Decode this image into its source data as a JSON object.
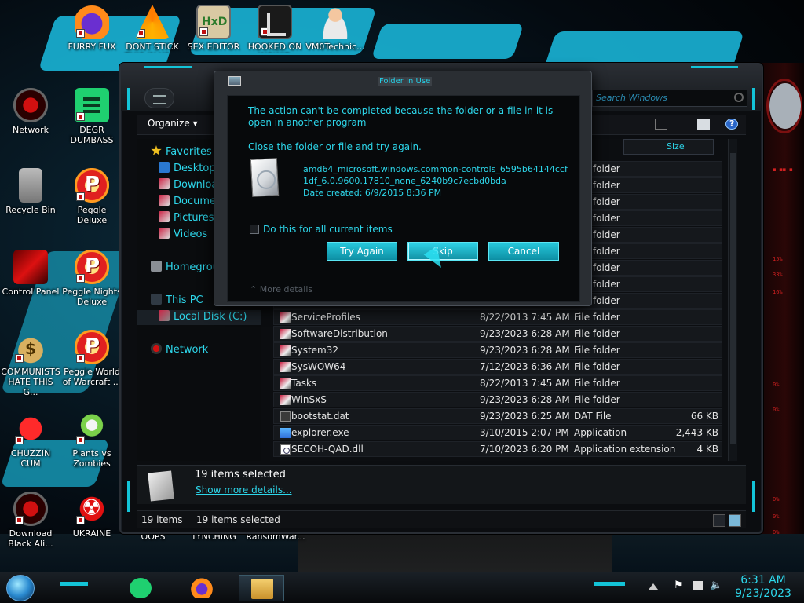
{
  "desktop": {
    "icons": [
      {
        "label": "FURRY FUX",
        "icon": "firefox-icon"
      },
      {
        "label": "DONT STICK THIS IN YO...",
        "icon": "vlc-icon"
      },
      {
        "label": "SEX EDITOR",
        "icon": "hxd-icon"
      },
      {
        "label": "HOOKED ON WOWIE",
        "icon": "hooked-icon"
      },
      {
        "label": "VM0Technic...",
        "icon": "doctor-icon"
      },
      {
        "label": "Network",
        "icon": "network-icon"
      },
      {
        "label": "DEGR DUMBASS",
        "icon": "green-app-icon"
      },
      {
        "label": "Recycle Bin",
        "icon": "recycle-bin-icon"
      },
      {
        "label": "Peggle Deluxe",
        "icon": "peggle-icon"
      },
      {
        "label": "Control Panel",
        "icon": "control-panel-icon"
      },
      {
        "label": "Peggle Nights Deluxe",
        "icon": "peggle-icon"
      },
      {
        "label": "COMMUNISTS HATE THIS G...",
        "icon": "money-bag-icon"
      },
      {
        "label": "Peggle World of Warcraft ...",
        "icon": "peggle-icon"
      },
      {
        "label": "CHUZZIN CUM",
        "icon": "chuzzle-icon"
      },
      {
        "label": "Plants vs Zombies",
        "icon": "pvz-icon"
      },
      {
        "label": "Download Black Ali...",
        "icon": "network-icon"
      },
      {
        "label": "UKRAINE",
        "icon": "radiation-icon"
      },
      {
        "label": "OOPS",
        "icon": ""
      },
      {
        "label": "LYNCHING",
        "icon": ""
      },
      {
        "label": "RansomWar...",
        "icon": ""
      }
    ]
  },
  "explorer": {
    "search_placeholder": "Search Windows",
    "organize_label": "Organize ▾",
    "column_size": "Size",
    "nav": {
      "favorites": "Favorites",
      "desktop": "Desktop",
      "downloads": "Downloads",
      "documents": "Documents",
      "pictures": "Pictures",
      "videos": "Videos",
      "homegroup": "Homegroup",
      "this_pc": "This PC",
      "local_disk": "Local Disk (C:)",
      "network": "Network"
    },
    "hidden_rows_type": "File folder",
    "files": [
      {
        "name": "ServiceProfiles",
        "date": "8/22/2013 7:45 AM",
        "type": "File folder",
        "size": ""
      },
      {
        "name": "SoftwareDistribution",
        "date": "9/23/2023 6:28 AM",
        "type": "File folder",
        "size": ""
      },
      {
        "name": "System32",
        "date": "9/23/2023 6:28 AM",
        "type": "File folder",
        "size": ""
      },
      {
        "name": "SysWOW64",
        "date": "7/12/2023 6:36 AM",
        "type": "File folder",
        "size": ""
      },
      {
        "name": "Tasks",
        "date": "8/22/2013 7:45 AM",
        "type": "File folder",
        "size": ""
      },
      {
        "name": "WinSxS",
        "date": "9/23/2023 6:28 AM",
        "type": "File folder",
        "size": ""
      },
      {
        "name": "bootstat.dat",
        "date": "9/23/2023 6:25 AM",
        "type": "DAT File",
        "size": "66 KB"
      },
      {
        "name": "explorer.exe",
        "date": "3/10/2015 2:07 PM",
        "type": "Application",
        "size": "2,443 KB"
      },
      {
        "name": "SECOH-QAD.dll",
        "date": "7/10/2023 6:20 PM",
        "type": "Application extension",
        "size": "4 KB"
      }
    ],
    "details": {
      "count": "19 items selected",
      "link": "Show more details..."
    },
    "status": {
      "items": "19 items",
      "selected": "19 items selected"
    }
  },
  "dialog": {
    "title": "Folder In Use",
    "message1": "The action can't be completed because the folder or a file in it is open in another program",
    "message2": "Close the folder or file and try again.",
    "file_name": "amd64_microsoft.windows.common-controls_6595b64144ccf1df_6.0.9600.17810_none_6240b9c7ecbd0bda",
    "date_created": "Date created: 6/9/2015 8:36 PM",
    "checkbox_label": "Do this for all current items",
    "checkbox_checked": false,
    "buttons": {
      "try_again": "Try Again",
      "skip": "Skip",
      "cancel": "Cancel"
    },
    "more_details": "More details"
  },
  "taskbar": {
    "apps": [
      "green-app-icon",
      "firefox-icon",
      "file-explorer-icon"
    ],
    "time": "6:31 AM",
    "date": "9/23/2023"
  },
  "colors": {
    "accent": "#2dd6ea",
    "button": "#13b4c8",
    "window_bg": "#0b0d10"
  }
}
